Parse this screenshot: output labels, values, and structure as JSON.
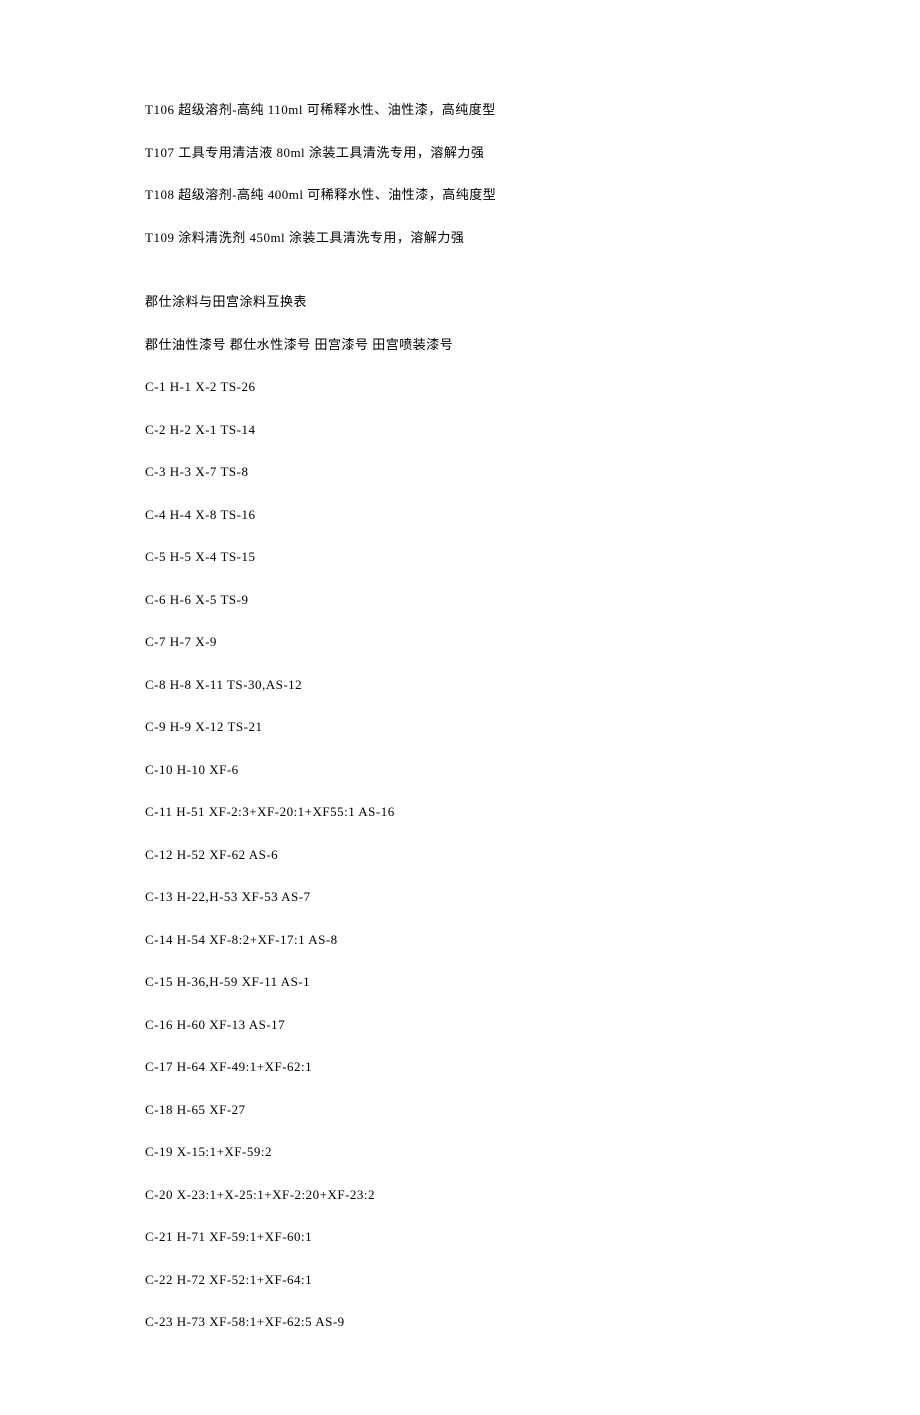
{
  "intro_lines": [
    "T106 超级溶剂-高纯 110ml 可稀释水性、油性漆，高纯度型",
    "T107 工具专用清洁液 80ml 涂装工具清洗专用，溶解力强",
    "T108 超级溶剂-高纯 400ml 可稀释水性、油性漆，高纯度型",
    "T109 涂料清洗剂 450ml 涂装工具清洗专用，溶解力强"
  ],
  "table_title": "郡仕涂料与田宫涂料互换表",
  "table_header": "郡仕油性漆号 郡仕水性漆号 田宫漆号 田宫喷装漆号",
  "rows": [
    "C-1 H-1 X-2 TS-26",
    "C-2 H-2 X-1 TS-14",
    "C-3 H-3 X-7 TS-8",
    "C-4 H-4 X-8 TS-16",
    "C-5 H-5 X-4 TS-15",
    "C-6 H-6 X-5 TS-9",
    "C-7 H-7 X-9",
    "C-8 H-8 X-11 TS-30,AS-12",
    "C-9 H-9 X-12 TS-21",
    "C-10 H-10 XF-6",
    "C-11 H-51 XF-2:3+XF-20:1+XF55:1 AS-16",
    "C-12 H-52 XF-62 AS-6",
    "C-13 H-22,H-53 XF-53 AS-7",
    "C-14 H-54 XF-8:2+XF-17:1 AS-8",
    "C-15 H-36,H-59 XF-11 AS-1",
    "C-16 H-60 XF-13 AS-17",
    "C-17 H-64 XF-49:1+XF-62:1",
    "C-18 H-65 XF-27",
    "C-19 X-15:1+XF-59:2",
    "C-20 X-23:1+X-25:1+XF-2:20+XF-23:2",
    "C-21 H-71 XF-59:1+XF-60:1",
    "C-22 H-72 XF-52:1+XF-64:1",
    "C-23 H-73 XF-58:1+XF-62:5 AS-9"
  ],
  "chart_data": {
    "type": "table",
    "title": "郡仕涂料与田宫涂料互换表",
    "columns": [
      "郡仕油性漆号",
      "郡仕水性漆号",
      "田宫漆号",
      "田宫喷装漆号"
    ],
    "data": [
      [
        "C-1",
        "H-1",
        "X-2",
        "TS-26"
      ],
      [
        "C-2",
        "H-2",
        "X-1",
        "TS-14"
      ],
      [
        "C-3",
        "H-3",
        "X-7",
        "TS-8"
      ],
      [
        "C-4",
        "H-4",
        "X-8",
        "TS-16"
      ],
      [
        "C-5",
        "H-5",
        "X-4",
        "TS-15"
      ],
      [
        "C-6",
        "H-6",
        "X-5",
        "TS-9"
      ],
      [
        "C-7",
        "H-7",
        "X-9",
        ""
      ],
      [
        "C-8",
        "H-8",
        "X-11",
        "TS-30,AS-12"
      ],
      [
        "C-9",
        "H-9",
        "X-12",
        "TS-21"
      ],
      [
        "C-10",
        "H-10",
        "XF-6",
        ""
      ],
      [
        "C-11",
        "H-51",
        "XF-2:3+XF-20:1+XF55:1",
        "AS-16"
      ],
      [
        "C-12",
        "H-52",
        "XF-62",
        "AS-6"
      ],
      [
        "C-13",
        "H-22,H-53",
        "XF-53",
        "AS-7"
      ],
      [
        "C-14",
        "H-54",
        "XF-8:2+XF-17:1",
        "AS-8"
      ],
      [
        "C-15",
        "H-36,H-59",
        "XF-11",
        "AS-1"
      ],
      [
        "C-16",
        "H-60",
        "XF-13",
        "AS-17"
      ],
      [
        "C-17",
        "H-64",
        "XF-49:1+XF-62:1",
        ""
      ],
      [
        "C-18",
        "H-65",
        "XF-27",
        ""
      ],
      [
        "C-19",
        "",
        "X-15:1+XF-59:2",
        ""
      ],
      [
        "C-20",
        "",
        "X-23:1+X-25:1+XF-2:20+XF-23:2",
        ""
      ],
      [
        "C-21",
        "H-71",
        "XF-59:1+XF-60:1",
        ""
      ],
      [
        "C-22",
        "H-72",
        "XF-52:1+XF-64:1",
        ""
      ],
      [
        "C-23",
        "H-73",
        "XF-58:1+XF-62:5",
        "AS-9"
      ]
    ]
  }
}
